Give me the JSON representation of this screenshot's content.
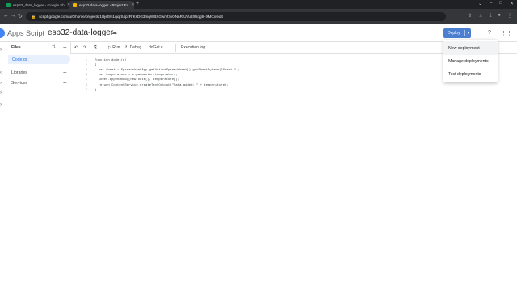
{
  "browser": {
    "tabs": [
      {
        "title": "esp32_data_logger - Google Sh",
        "active": false,
        "favicon_color": "#0f9d58"
      },
      {
        "title": "esp32-data-logger - Project Ed",
        "active": true,
        "favicon_color": "#f4b400"
      }
    ],
    "url": "script.google.com/u/0/home/projects/1l9jet9h1qiqfS4pzRrKsDG3mqWBSGwryf3vONnRtUVu3Xfrqg9l-XMCx/edit"
  },
  "header": {
    "app_name": "Apps Script",
    "project_name": "esp32-data-logger",
    "deploy_label": "Deploy",
    "accent": "#4d7fd1"
  },
  "sidebar": {
    "files_label": "Files",
    "file_name": "Code.gs",
    "libraries_label": "Libraries",
    "services_label": "Services",
    "add_icon": "plus-icon"
  },
  "toolbar": {
    "run_label": "Run",
    "debug_label": "Debug",
    "function_name": "doGet",
    "log_label": "Execution log"
  },
  "code": {
    "lines": [
      "function doGet(e)",
      "{",
      "  var sheet = SpreadsheetApp.getActiveSpreadsheet().getSheetByName(\"Sheet1\");",
      "  var temperature = e.parameter.temperature;",
      "  sheet.appendRow([new Date(), temperature]);",
      "  return ContentService.createTextOutput(\"Data added: \" + temperature);",
      "}"
    ]
  },
  "deploy_menu": {
    "items": [
      "New deployment",
      "Manage deployments",
      "Test deployments"
    ]
  }
}
